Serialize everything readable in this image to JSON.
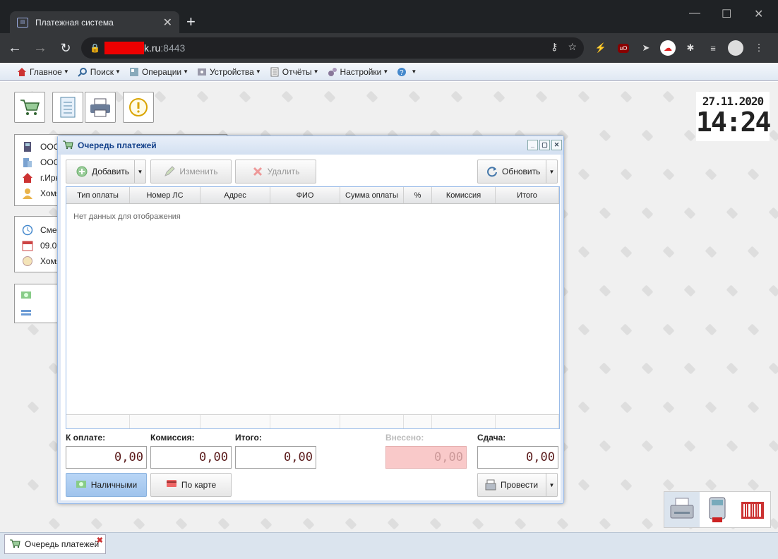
{
  "browser": {
    "tab_title": "Платежная система",
    "url_domain": "k.ru",
    "url_port": ":8443"
  },
  "menu": [
    {
      "label": "Главное",
      "icon": "home-icon"
    },
    {
      "label": "Поиск",
      "icon": "search-icon"
    },
    {
      "label": "Операции",
      "icon": "operations-icon"
    },
    {
      "label": "Устройства",
      "icon": "devices-icon"
    },
    {
      "label": "Отчёты",
      "icon": "reports-icon"
    },
    {
      "label": "Настройки",
      "icon": "settings-icon"
    },
    {
      "label": "",
      "icon": "help-icon"
    }
  ],
  "info_panel": [
    "ООО",
    "ООО",
    "г.Ирк",
    "Хомя"
  ],
  "shift_panel": [
    "Смен",
    "09.09",
    "Хомя"
  ],
  "clock": {
    "date": "27.11.2020",
    "time": "14:24"
  },
  "dialog": {
    "title": "Очередь платежей",
    "buttons": {
      "add": "Добавить",
      "edit": "Изменить",
      "delete": "Удалить",
      "refresh": "Обновить"
    },
    "columns": [
      "Тип оплаты",
      "Номер ЛС",
      "Адрес",
      "ФИО",
      "Сумма оплаты",
      "%",
      "Комиссия",
      "Итого"
    ],
    "empty_text": "Нет данных для отображения",
    "totals": {
      "to_pay_label": "К оплате:",
      "to_pay": "0,00",
      "commission_label": "Комиссия:",
      "commission": "0,00",
      "total_label": "Итого:",
      "total": "0,00",
      "deposited_label": "Внесено:",
      "deposited": "0,00",
      "change_label": "Сдача:",
      "change": "0,00"
    },
    "pay_cash": "Наличными",
    "pay_card": "По карте",
    "submit": "Провести"
  },
  "taskbar": {
    "item": "Очередь платежей"
  }
}
